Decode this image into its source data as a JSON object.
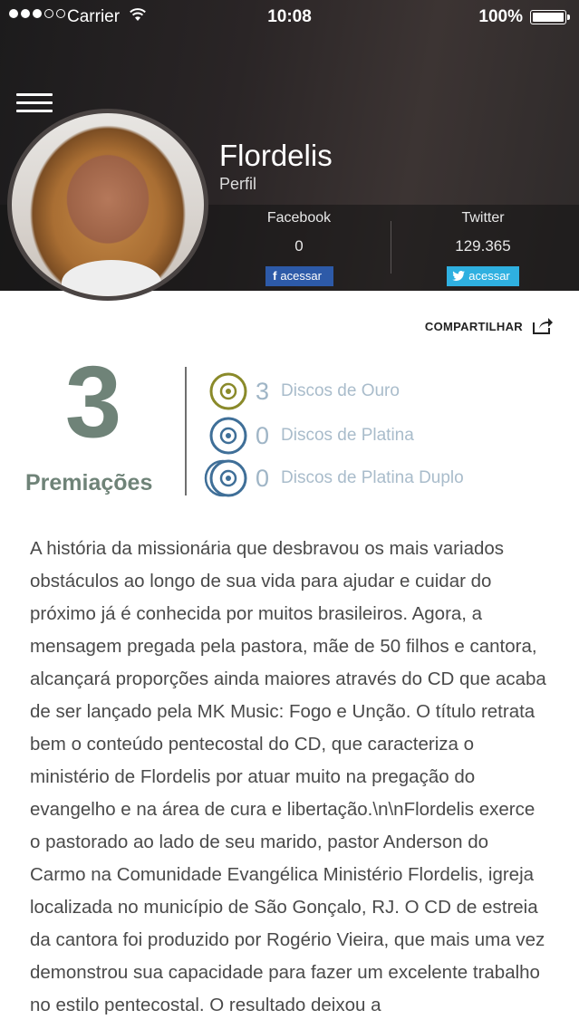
{
  "status_bar": {
    "carrier": "Carrier",
    "time": "10:08",
    "battery": "100%"
  },
  "profile": {
    "name": "Flordelis",
    "subtitle": "Perfil"
  },
  "social": {
    "facebook": {
      "label": "Facebook",
      "count": "0",
      "button_label": "acessar",
      "icon": "f"
    },
    "twitter": {
      "label": "Twitter",
      "count": "129.365",
      "button_label": "acessar",
      "icon": "bird-icon"
    }
  },
  "share": {
    "label": "COMPARTILHAR"
  },
  "awards": {
    "total": "3",
    "label": "Premiações",
    "items": [
      {
        "count": "3",
        "label": "Discos de Ouro",
        "color": "#8a8a2a"
      },
      {
        "count": "0",
        "label": "Discos de Platina",
        "color": "#3f6f98"
      },
      {
        "count": "0",
        "label": "Discos de Platina Duplo",
        "color": "#3f6f98"
      }
    ]
  },
  "description": "A história da missionária que desbravou os mais variados obstáculos ao longo de sua vida para ajudar e cuidar do próximo já é conhecida por muitos brasileiros. Agora, a mensagem pregada pela pastora, mãe de 50 filhos e cantora, alcançará proporções ainda maiores através do CD que acaba de ser lançado pela MK Music: Fogo e Unção. O título retrata bem o conteúdo pentecostal do CD, que caracteriza o ministério de Flordelis por atuar muito na pregação do evangelho e na área de cura e libertação.\\n\\nFlordelis exerce o pastorado ao lado de seu marido, pastor Anderson do Carmo na Comunidade Evangélica Ministério Flordelis, igreja localizada no município de São Gonçalo, RJ. O CD de estreia da cantora foi produzido por Rogério Vieira, que mais uma vez demonstrou sua capacidade para fazer um excelente trabalho no estilo pentecostal. O resultado deixou a"
}
